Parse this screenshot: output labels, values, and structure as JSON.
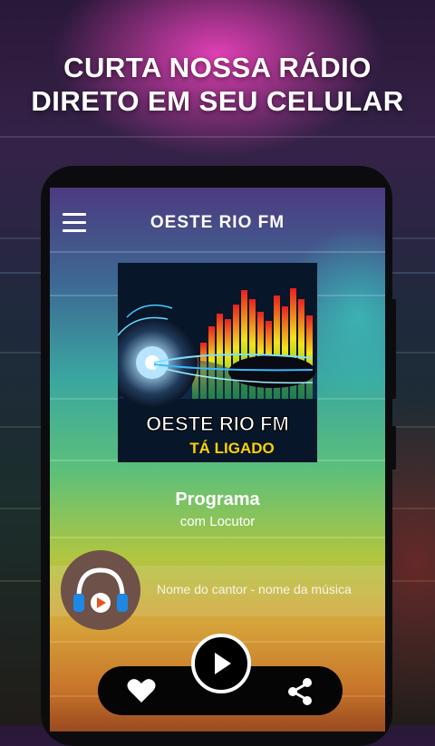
{
  "promo": {
    "line1": "CURTA NOSSA RÁDIO",
    "line2": "DIRETO EM SEU CELULAR"
  },
  "app": {
    "station_name": "OESTE RIO FM",
    "cover": {
      "title": "OESTE RIO FM",
      "tagline": "TÁ LIGADO"
    },
    "program": "Programa",
    "host": "com Locutor",
    "track": "Nome do cantor - nome da música",
    "icons": {
      "menu": "hamburger-menu-icon",
      "avatar": "headphones-icon",
      "play": "play-icon",
      "like": "heart-icon",
      "share": "share-icon"
    }
  },
  "colors": {
    "text": "#ffffff",
    "tagline": "#ffd000",
    "bar": "#050505",
    "avatar_bg": "#6e5148",
    "headphones_accent": "#1e88e5",
    "play_accent": "#e8531f"
  }
}
